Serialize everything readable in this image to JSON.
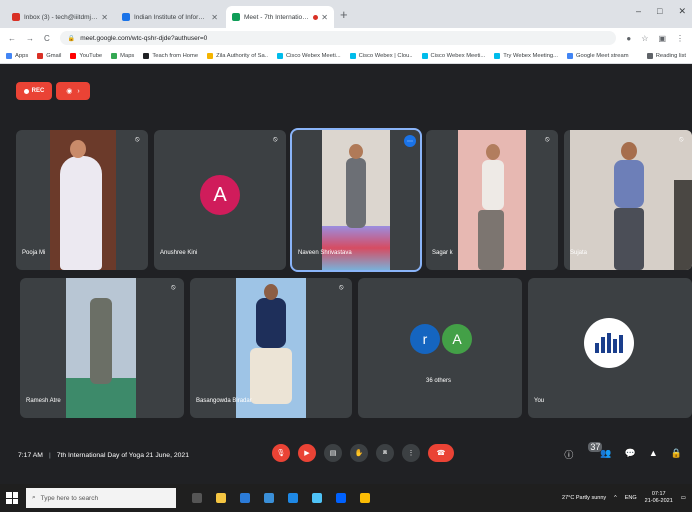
{
  "browser": {
    "tabs": [
      {
        "label": "Inbox (3) - tech@iiitdmj.ac.in",
        "fav_color": "#d93025",
        "active": false
      },
      {
        "label": "Indian Institute of Information T",
        "fav_color": "#1a73e8",
        "active": false
      },
      {
        "label": "Meet - 7th International Da",
        "fav_color": "#0f9d58",
        "active": true
      }
    ],
    "new_tab": "+",
    "window_controls": [
      "–",
      "□",
      "✕"
    ],
    "url": "meet.google.com/wtc-qshr-djde?authuser=0",
    "nav_icons": [
      "←",
      "→",
      "C"
    ],
    "addr_right_icons": [
      "●",
      "☆",
      "▣",
      "⋮"
    ],
    "bookmarks": [
      {
        "label": "Apps",
        "color": "#4285f4"
      },
      {
        "label": "Gmail",
        "color": "#d93025"
      },
      {
        "label": "YouTube",
        "color": "#ff0000"
      },
      {
        "label": "Maps",
        "color": "#34a853"
      },
      {
        "label": "Teach from Home",
        "color": "#202124"
      },
      {
        "label": "Zila Authority of Sa..",
        "color": "#f4b400"
      },
      {
        "label": "Cisco Webex Meeti...",
        "color": "#00bceb"
      },
      {
        "label": "Cisco Webex | Clou..",
        "color": "#00bceb"
      },
      {
        "label": "Cisco Webex Meeti...",
        "color": "#00bceb"
      },
      {
        "label": "Try Webex Meeting...",
        "color": "#00bceb"
      },
      {
        "label": "Google Meet stream",
        "color": "#4285f4"
      }
    ],
    "reading_list": "Reading list"
  },
  "meet": {
    "rec_label": "REC",
    "participants": [
      {
        "name": "Pooja Mi",
        "kind": "video",
        "bg": "#6b3a2a",
        "shirt": "#e8e6ef"
      },
      {
        "name": "Anushree Kini",
        "kind": "avatar",
        "initial": "A"
      },
      {
        "name": "Naveen Shrivastava",
        "kind": "video",
        "bg": "#dcd6cf",
        "shirt": "#6c6f75",
        "active": true
      },
      {
        "name": "Sagar k",
        "kind": "video",
        "bg": "#e7b8b2",
        "shirt": "#e9e6e3"
      },
      {
        "name": "Sujata",
        "kind": "video",
        "bg": "#d6cfc8",
        "shirt": "#6d7fb8"
      },
      {
        "name": "Ramesh Atre",
        "kind": "video",
        "bg": "#b8c6d4",
        "shirt": "#6b6f66"
      },
      {
        "name": "Basangowda Biradar",
        "kind": "video",
        "bg": "#9ec4e6",
        "shirt": "#1e2f5a"
      },
      {
        "name": "",
        "kind": "others",
        "others_label": "36 others",
        "initials": [
          "r",
          "A"
        ]
      },
      {
        "name": "You",
        "kind": "logo"
      }
    ],
    "meeting_time": "7:17 AM",
    "meeting_title": "7th International Day of Yoga 21 June, 2021",
    "controls": [
      "mic-off",
      "camera-off",
      "captions",
      "raise-hand",
      "present",
      "more",
      "end-call"
    ],
    "right_controls": [
      "info",
      "people",
      "chat",
      "activities",
      "lock"
    ],
    "people_count": "37"
  },
  "taskbar": {
    "search_placeholder": "Type here to search",
    "weather": "27°C Partly sunny",
    "lang": "ENG",
    "time": "07:17",
    "date": "21-06-2021"
  }
}
